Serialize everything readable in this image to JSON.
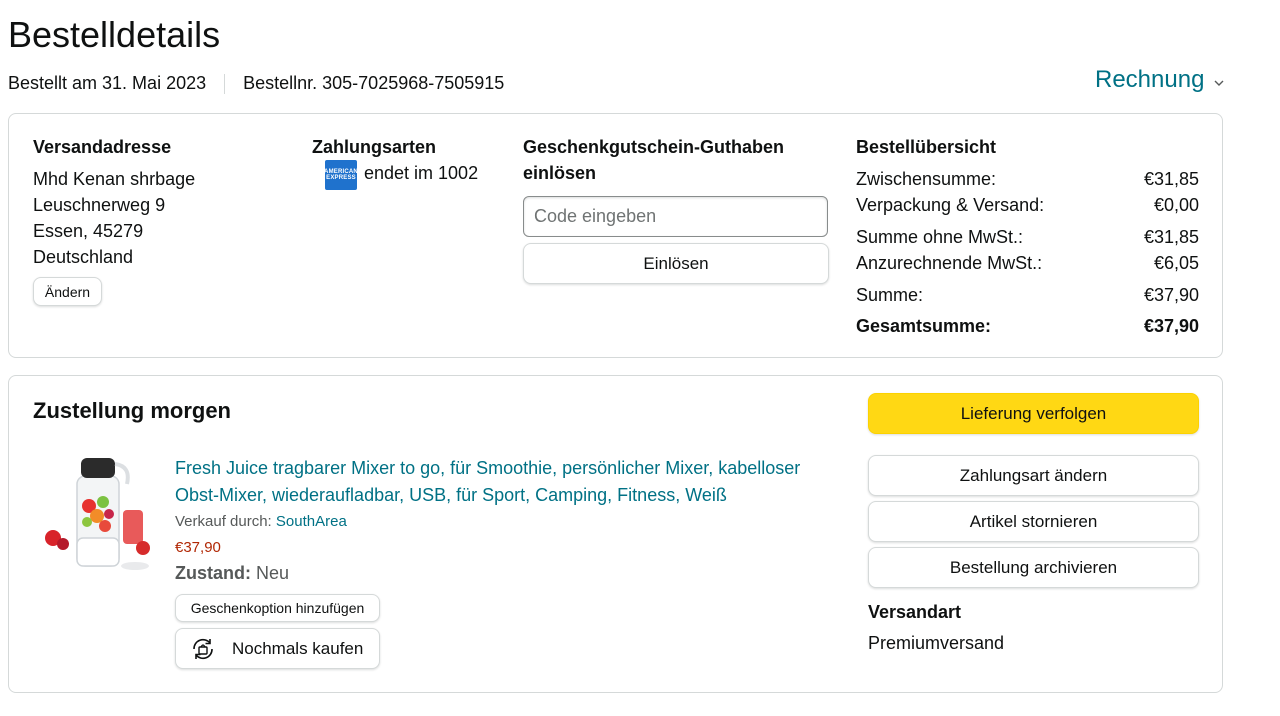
{
  "header": {
    "title": "Bestelldetails",
    "order_date": "Bestellt am 31. Mai 2023",
    "order_number": "Bestellnr. 305-7025968-7505915",
    "invoice_label": "Rechnung",
    "invoice_chevron": "›"
  },
  "shipping_address": {
    "heading": "Versandadresse",
    "lines": [
      "Mhd Kenan shrbage",
      "Leuschnerweg 9",
      "Essen, 45279",
      "Deutschland"
    ],
    "change_button": "Ändern"
  },
  "payment": {
    "heading": "Zahlungsarten",
    "card_icon": "amex-card-icon",
    "card_logo_text": "AMERICAN EXPRESS",
    "card_text": "endet im 1002"
  },
  "gift_card": {
    "heading_line1": "Geschenkgutschein-Guthaben",
    "heading_line2": "einlösen",
    "placeholder": "Code eingeben",
    "value": "",
    "redeem_button": "Einlösen"
  },
  "summary": {
    "heading": "Bestellübersicht",
    "rows": [
      {
        "label": "Zwischensumme:",
        "value": "€31,85"
      },
      {
        "label": "Verpackung & Versand:",
        "value": "€0,00"
      },
      {
        "label": "Summe ohne MwSt.:",
        "value": "€31,85"
      },
      {
        "label": "Anzurechnende MwSt.:",
        "value": "€6,05"
      },
      {
        "label": "Summe:",
        "value": "€37,90"
      },
      {
        "label": "Gesamtsumme:",
        "value": "€37,90"
      }
    ]
  },
  "delivery": {
    "title": "Zustellung morgen",
    "product": {
      "title": "Fresh Juice tragbarer Mixer to go, für Smoothie, persönlicher Mixer, kabelloser Obst-Mixer, wiederaufladbar, USB, für Sport, Camping, Fitness, Weiß",
      "seller_label": "Verkauf durch:",
      "seller_name": "SouthArea",
      "price": "€37,90",
      "condition_label": "Zustand:",
      "condition_value": "Neu",
      "gift_option_button": "Geschenkoption hinzufügen",
      "buy_again_button": "Nochmals kaufen"
    },
    "actions": {
      "track": "Lieferung verfolgen",
      "change_payment": "Zahlungsart ändern",
      "cancel_item": "Artikel stornieren",
      "archive_order": "Bestellung archivieren"
    },
    "shipping_method_heading": "Versandart",
    "shipping_method_value": "Premiumversand"
  },
  "colors": {
    "link": "#007185",
    "price": "#b12704",
    "primary_button": "#ffd814",
    "border": "#d5d9d9"
  }
}
